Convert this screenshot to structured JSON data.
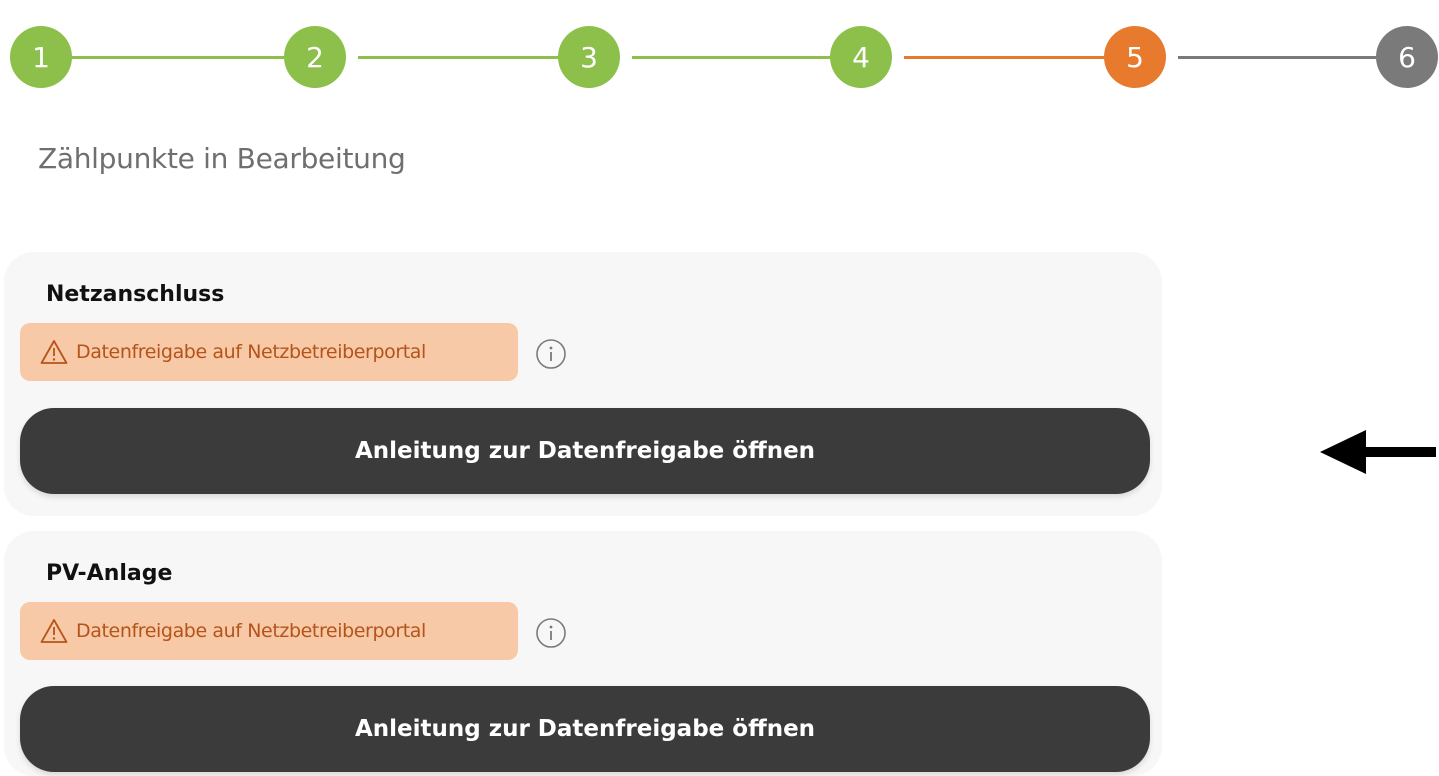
{
  "stepper": {
    "steps": [
      {
        "label": "1",
        "state": "completed",
        "color": "#8dbf4b"
      },
      {
        "label": "2",
        "state": "completed",
        "color": "#8dbf4b"
      },
      {
        "label": "3",
        "state": "completed",
        "color": "#8dbf4b"
      },
      {
        "label": "4",
        "state": "completed",
        "color": "#8dbf4b"
      },
      {
        "label": "5",
        "state": "active",
        "color": "#e87a2e"
      },
      {
        "label": "6",
        "state": "pending",
        "color": "#7a7a7a"
      }
    ]
  },
  "section_title": "Zählpunkte in Bearbeitung",
  "cards": [
    {
      "title": "Netzanschluss",
      "badge_text": "Datenfreigabe auf Netzbetreiberportal",
      "button_label": "Anleitung zur Datenfreigabe öffnen"
    },
    {
      "title": "PV-Anlage",
      "badge_text": "Datenfreigabe auf Netzbetreiberportal",
      "button_label": "Anleitung zur Datenfreigabe öffnen"
    }
  ],
  "colors": {
    "completed": "#8dbf4b",
    "active": "#e87a2e",
    "pending": "#7a7a7a",
    "badge_bg": "#f7c9a6",
    "badge_text": "#b5541a",
    "button_bg": "#3b3b3b"
  },
  "icons": {
    "badge": "warning-triangle-icon",
    "info": "info-circle-icon",
    "annotation": "left-arrow-icon"
  }
}
